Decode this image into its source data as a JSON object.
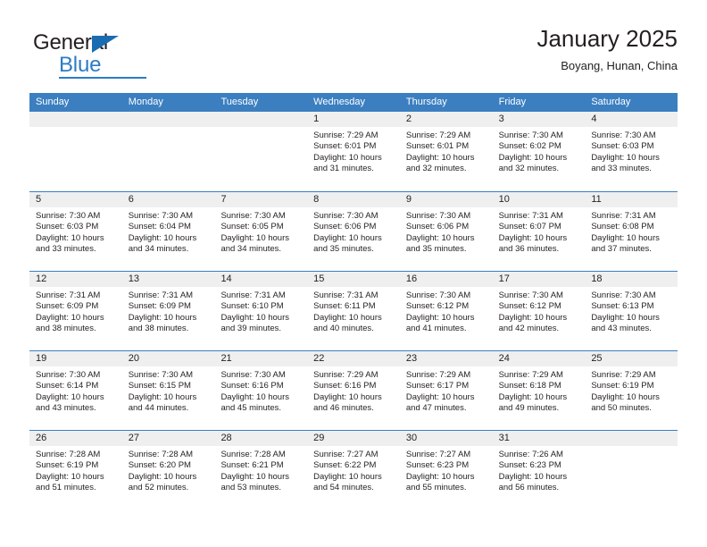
{
  "brand": {
    "name_part1": "General",
    "name_part2": "Blue"
  },
  "header": {
    "title": "January 2025",
    "subtitle": "Boyang, Hunan, China"
  },
  "colors": {
    "header_blue": "#3b7fc0",
    "brand_blue": "#2b7cc4",
    "day_band_gray": "#efefef",
    "text": "#231f20"
  },
  "weekdays": [
    "Sunday",
    "Monday",
    "Tuesday",
    "Wednesday",
    "Thursday",
    "Friday",
    "Saturday"
  ],
  "weeks": [
    [
      {
        "day": "",
        "lines": []
      },
      {
        "day": "",
        "lines": []
      },
      {
        "day": "",
        "lines": []
      },
      {
        "day": "1",
        "lines": [
          "Sunrise: 7:29 AM",
          "Sunset: 6:01 PM",
          "Daylight: 10 hours",
          "and 31 minutes."
        ]
      },
      {
        "day": "2",
        "lines": [
          "Sunrise: 7:29 AM",
          "Sunset: 6:01 PM",
          "Daylight: 10 hours",
          "and 32 minutes."
        ]
      },
      {
        "day": "3",
        "lines": [
          "Sunrise: 7:30 AM",
          "Sunset: 6:02 PM",
          "Daylight: 10 hours",
          "and 32 minutes."
        ]
      },
      {
        "day": "4",
        "lines": [
          "Sunrise: 7:30 AM",
          "Sunset: 6:03 PM",
          "Daylight: 10 hours",
          "and 33 minutes."
        ]
      }
    ],
    [
      {
        "day": "5",
        "lines": [
          "Sunrise: 7:30 AM",
          "Sunset: 6:03 PM",
          "Daylight: 10 hours",
          "and 33 minutes."
        ]
      },
      {
        "day": "6",
        "lines": [
          "Sunrise: 7:30 AM",
          "Sunset: 6:04 PM",
          "Daylight: 10 hours",
          "and 34 minutes."
        ]
      },
      {
        "day": "7",
        "lines": [
          "Sunrise: 7:30 AM",
          "Sunset: 6:05 PM",
          "Daylight: 10 hours",
          "and 34 minutes."
        ]
      },
      {
        "day": "8",
        "lines": [
          "Sunrise: 7:30 AM",
          "Sunset: 6:06 PM",
          "Daylight: 10 hours",
          "and 35 minutes."
        ]
      },
      {
        "day": "9",
        "lines": [
          "Sunrise: 7:30 AM",
          "Sunset: 6:06 PM",
          "Daylight: 10 hours",
          "and 35 minutes."
        ]
      },
      {
        "day": "10",
        "lines": [
          "Sunrise: 7:31 AM",
          "Sunset: 6:07 PM",
          "Daylight: 10 hours",
          "and 36 minutes."
        ]
      },
      {
        "day": "11",
        "lines": [
          "Sunrise: 7:31 AM",
          "Sunset: 6:08 PM",
          "Daylight: 10 hours",
          "and 37 minutes."
        ]
      }
    ],
    [
      {
        "day": "12",
        "lines": [
          "Sunrise: 7:31 AM",
          "Sunset: 6:09 PM",
          "Daylight: 10 hours",
          "and 38 minutes."
        ]
      },
      {
        "day": "13",
        "lines": [
          "Sunrise: 7:31 AM",
          "Sunset: 6:09 PM",
          "Daylight: 10 hours",
          "and 38 minutes."
        ]
      },
      {
        "day": "14",
        "lines": [
          "Sunrise: 7:31 AM",
          "Sunset: 6:10 PM",
          "Daylight: 10 hours",
          "and 39 minutes."
        ]
      },
      {
        "day": "15",
        "lines": [
          "Sunrise: 7:31 AM",
          "Sunset: 6:11 PM",
          "Daylight: 10 hours",
          "and 40 minutes."
        ]
      },
      {
        "day": "16",
        "lines": [
          "Sunrise: 7:30 AM",
          "Sunset: 6:12 PM",
          "Daylight: 10 hours",
          "and 41 minutes."
        ]
      },
      {
        "day": "17",
        "lines": [
          "Sunrise: 7:30 AM",
          "Sunset: 6:12 PM",
          "Daylight: 10 hours",
          "and 42 minutes."
        ]
      },
      {
        "day": "18",
        "lines": [
          "Sunrise: 7:30 AM",
          "Sunset: 6:13 PM",
          "Daylight: 10 hours",
          "and 43 minutes."
        ]
      }
    ],
    [
      {
        "day": "19",
        "lines": [
          "Sunrise: 7:30 AM",
          "Sunset: 6:14 PM",
          "Daylight: 10 hours",
          "and 43 minutes."
        ]
      },
      {
        "day": "20",
        "lines": [
          "Sunrise: 7:30 AM",
          "Sunset: 6:15 PM",
          "Daylight: 10 hours",
          "and 44 minutes."
        ]
      },
      {
        "day": "21",
        "lines": [
          "Sunrise: 7:30 AM",
          "Sunset: 6:16 PM",
          "Daylight: 10 hours",
          "and 45 minutes."
        ]
      },
      {
        "day": "22",
        "lines": [
          "Sunrise: 7:29 AM",
          "Sunset: 6:16 PM",
          "Daylight: 10 hours",
          "and 46 minutes."
        ]
      },
      {
        "day": "23",
        "lines": [
          "Sunrise: 7:29 AM",
          "Sunset: 6:17 PM",
          "Daylight: 10 hours",
          "and 47 minutes."
        ]
      },
      {
        "day": "24",
        "lines": [
          "Sunrise: 7:29 AM",
          "Sunset: 6:18 PM",
          "Daylight: 10 hours",
          "and 49 minutes."
        ]
      },
      {
        "day": "25",
        "lines": [
          "Sunrise: 7:29 AM",
          "Sunset: 6:19 PM",
          "Daylight: 10 hours",
          "and 50 minutes."
        ]
      }
    ],
    [
      {
        "day": "26",
        "lines": [
          "Sunrise: 7:28 AM",
          "Sunset: 6:19 PM",
          "Daylight: 10 hours",
          "and 51 minutes."
        ]
      },
      {
        "day": "27",
        "lines": [
          "Sunrise: 7:28 AM",
          "Sunset: 6:20 PM",
          "Daylight: 10 hours",
          "and 52 minutes."
        ]
      },
      {
        "day": "28",
        "lines": [
          "Sunrise: 7:28 AM",
          "Sunset: 6:21 PM",
          "Daylight: 10 hours",
          "and 53 minutes."
        ]
      },
      {
        "day": "29",
        "lines": [
          "Sunrise: 7:27 AM",
          "Sunset: 6:22 PM",
          "Daylight: 10 hours",
          "and 54 minutes."
        ]
      },
      {
        "day": "30",
        "lines": [
          "Sunrise: 7:27 AM",
          "Sunset: 6:23 PM",
          "Daylight: 10 hours",
          "and 55 minutes."
        ]
      },
      {
        "day": "31",
        "lines": [
          "Sunrise: 7:26 AM",
          "Sunset: 6:23 PM",
          "Daylight: 10 hours",
          "and 56 minutes."
        ]
      },
      {
        "day": "",
        "lines": []
      }
    ]
  ]
}
